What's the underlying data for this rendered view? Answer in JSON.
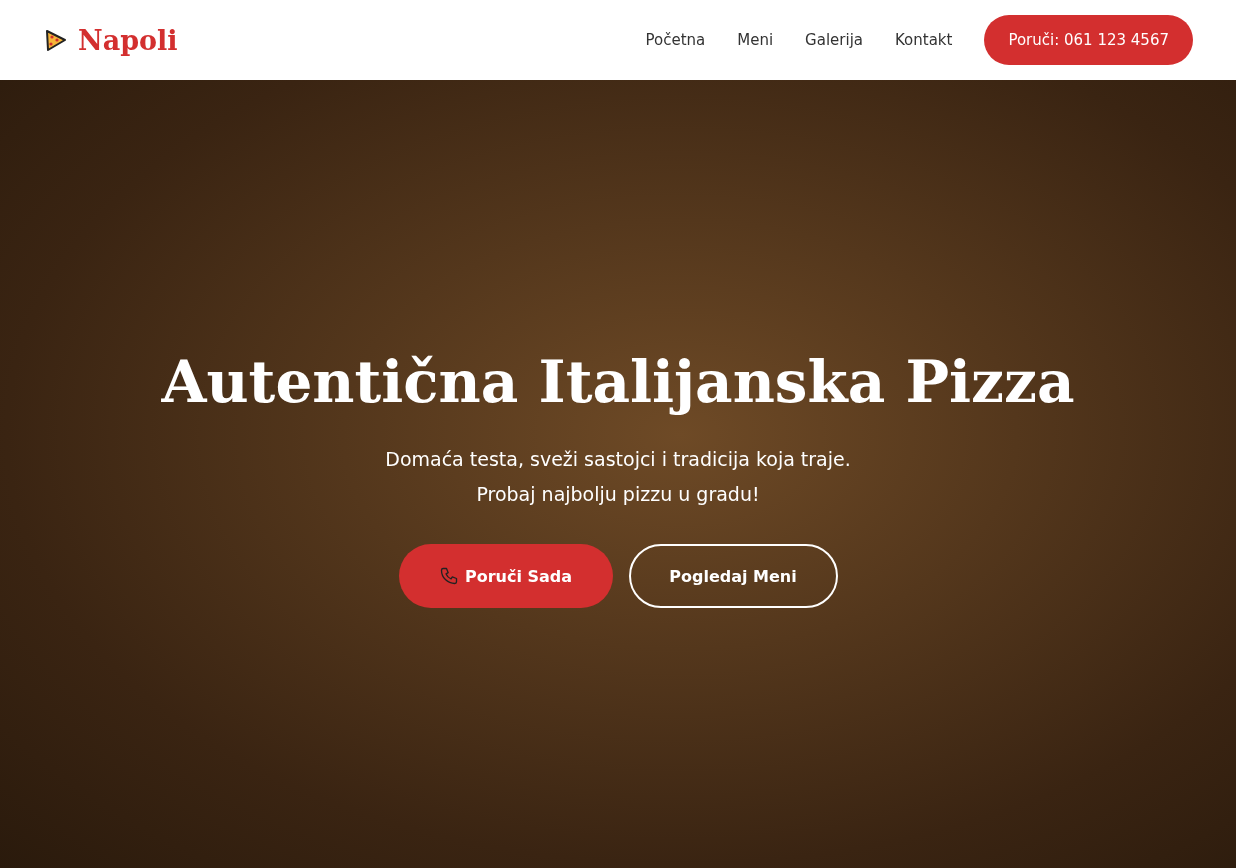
{
  "header": {
    "brand": "Napoli",
    "nav": [
      {
        "label": "Početna"
      },
      {
        "label": "Meni"
      },
      {
        "label": "Galerija"
      },
      {
        "label": "Kontakt"
      }
    ],
    "cta": "Poruči: 061 123 4567"
  },
  "hero": {
    "title": "Autentična Italijanska Pizza",
    "subtitle_lines": [
      "Domaća testa, sveži sastojci i tradicija koja traje.",
      "Probaj najbolju pizzu u gradu!"
    ],
    "buttons": [
      {
        "label": "Poruči Sada",
        "kind": "primary"
      },
      {
        "label": "Pogledaj Meni",
        "kind": "outline"
      }
    ]
  }
}
